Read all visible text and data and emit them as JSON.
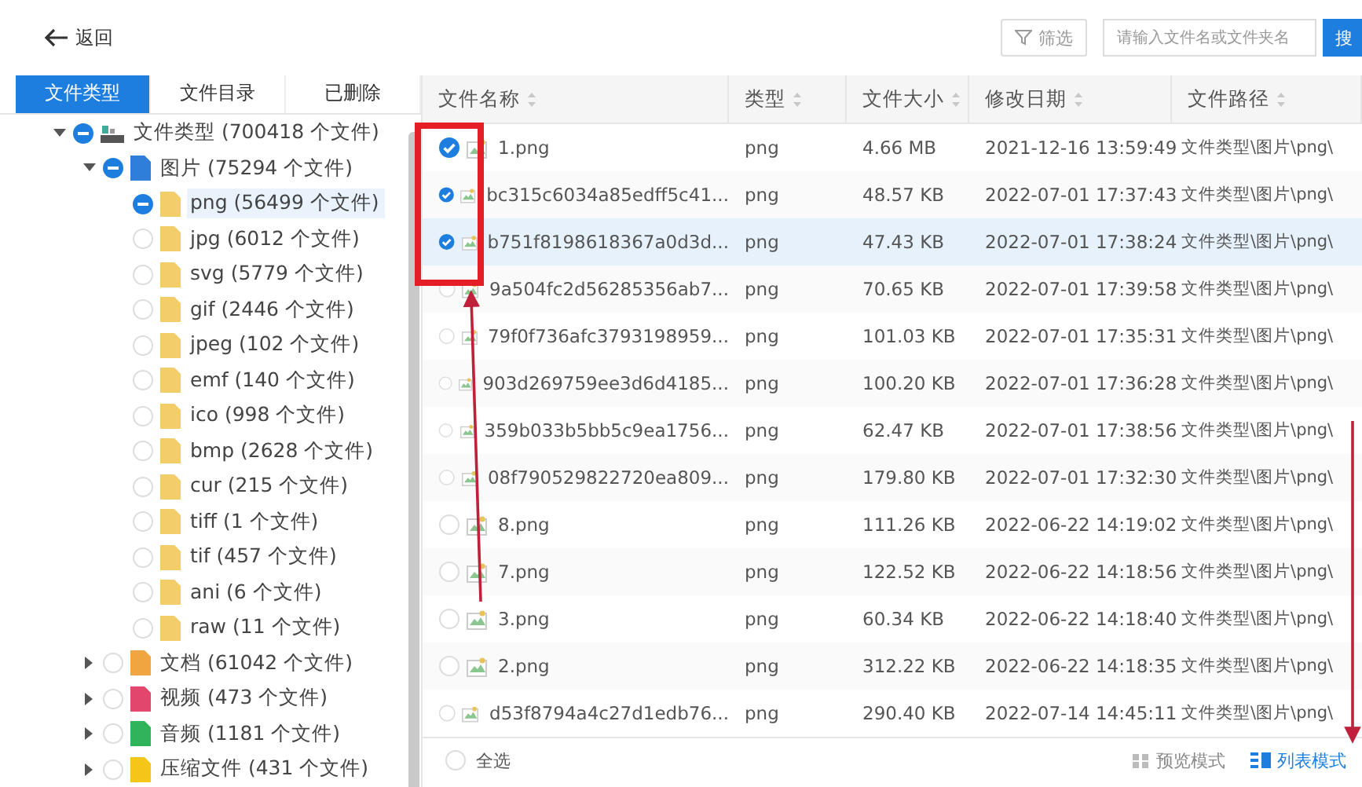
{
  "topbar": {
    "back": "返回",
    "filter": "筛选",
    "search": {
      "placeholder": "请输入文件名或文件夹名"
    },
    "search_button": "搜"
  },
  "sidebar": {
    "tabs": [
      {
        "label": "文件类型",
        "selected": true
      },
      {
        "label": "文件目录",
        "selected": false
      },
      {
        "label": "已删除",
        "selected": false
      }
    ],
    "tree": [
      {
        "label": "文件类型 (700418 个文件)",
        "kind": "drive",
        "checked": false,
        "indeterminate": true,
        "selected": false,
        "expanded": true,
        "children": [
          {
            "label": "图片 (75294 个文件)",
            "kind": "folder",
            "color": "#2f7fd8",
            "checked": false,
            "indeterminate": true,
            "selected": false,
            "expanded": true,
            "children": [
              {
                "label": "png (56499 个文件)",
                "kind": "folder",
                "color": "#f3cd6a",
                "checked": false,
                "indeterminate": true,
                "selected": true
              },
              {
                "label": "jpg (6012 个文件)",
                "kind": "folder",
                "color": "#f3cd6a",
                "checked": false,
                "indeterminate": false,
                "selected": false
              },
              {
                "label": "svg (5779 个文件)",
                "kind": "folder",
                "color": "#f3cd6a",
                "checked": false,
                "indeterminate": false,
                "selected": false
              },
              {
                "label": "gif (2446 个文件)",
                "kind": "folder",
                "color": "#f3cd6a",
                "checked": false,
                "indeterminate": false,
                "selected": false
              },
              {
                "label": "jpeg (102 个文件)",
                "kind": "folder",
                "color": "#f3cd6a",
                "checked": false,
                "indeterminate": false,
                "selected": false
              },
              {
                "label": "emf (140 个文件)",
                "kind": "folder",
                "color": "#f3cd6a",
                "checked": false,
                "indeterminate": false,
                "selected": false
              },
              {
                "label": "ico (998 个文件)",
                "kind": "folder",
                "color": "#f3cd6a",
                "checked": false,
                "indeterminate": false,
                "selected": false
              },
              {
                "label": "bmp (2628 个文件)",
                "kind": "folder",
                "color": "#f3cd6a",
                "checked": false,
                "indeterminate": false,
                "selected": false
              },
              {
                "label": "cur (215 个文件)",
                "kind": "folder",
                "color": "#f3cd6a",
                "checked": false,
                "indeterminate": false,
                "selected": false
              },
              {
                "label": "tiff (1 个文件)",
                "kind": "folder",
                "color": "#f3cd6a",
                "checked": false,
                "indeterminate": false,
                "selected": false
              },
              {
                "label": "tif (457 个文件)",
                "kind": "folder",
                "color": "#f3cd6a",
                "checked": false,
                "indeterminate": false,
                "selected": false
              },
              {
                "label": "ani (6 个文件)",
                "kind": "folder",
                "color": "#f3cd6a",
                "checked": false,
                "indeterminate": false,
                "selected": false
              },
              {
                "label": "raw (11 个文件)",
                "kind": "folder",
                "color": "#f3cd6a",
                "checked": false,
                "indeterminate": false,
                "selected": false
              }
            ]
          },
          {
            "label": "文档 (61042 个文件)",
            "kind": "folder",
            "color": "#f0a540",
            "checked": false,
            "indeterminate": false,
            "selected": false,
            "expanded": false
          },
          {
            "label": "视频 (473 个文件)",
            "kind": "folder",
            "color": "#e2466c",
            "checked": false,
            "indeterminate": false,
            "selected": false,
            "expanded": false
          },
          {
            "label": "音频 (1181 个文件)",
            "kind": "folder",
            "color": "#2fb45a",
            "checked": false,
            "indeterminate": false,
            "selected": false,
            "expanded": false
          },
          {
            "label": "压缩文件 (431 个文件)",
            "kind": "folder",
            "color": "#f5c518",
            "checked": false,
            "indeterminate": false,
            "selected": false,
            "expanded": false
          }
        ]
      }
    ]
  },
  "table": {
    "columns": [
      "文件名称",
      "类型",
      "文件大小",
      "修改日期",
      "文件路径"
    ],
    "rows": [
      {
        "name": "1.png",
        "type": "png",
        "size": "4.66 MB",
        "date": "2021-12-16 13:59:49",
        "path": "文件类型\\图片\\png\\",
        "checked": true,
        "selected": false
      },
      {
        "name": "bc315c6034a85edff5c41...",
        "type": "png",
        "size": "48.57 KB",
        "date": "2022-07-01 17:37:43",
        "path": "文件类型\\图片\\png\\",
        "checked": true,
        "selected": false
      },
      {
        "name": "b751f8198618367a0d3d...",
        "type": "png",
        "size": "47.43 KB",
        "date": "2022-07-01 17:38:24",
        "path": "文件类型\\图片\\png\\",
        "checked": true,
        "selected": true
      },
      {
        "name": "9a504fc2d56285356ab7...",
        "type": "png",
        "size": "70.65 KB",
        "date": "2022-07-01 17:39:58",
        "path": "文件类型\\图片\\png\\",
        "checked": false,
        "selected": false
      },
      {
        "name": "79f0f736afc3793198959...",
        "type": "png",
        "size": "101.03 KB",
        "date": "2022-07-01 17:35:31",
        "path": "文件类型\\图片\\png\\",
        "checked": false,
        "selected": false
      },
      {
        "name": "903d269759ee3d6d4185...",
        "type": "png",
        "size": "100.20 KB",
        "date": "2022-07-01 17:36:28",
        "path": "文件类型\\图片\\png\\",
        "checked": false,
        "selected": false
      },
      {
        "name": "359b033b5bb5c9ea1756...",
        "type": "png",
        "size": "62.47 KB",
        "date": "2022-07-01 17:38:56",
        "path": "文件类型\\图片\\png\\",
        "checked": false,
        "selected": false
      },
      {
        "name": "08f790529822720ea809...",
        "type": "png",
        "size": "179.80 KB",
        "date": "2022-07-01 17:32:30",
        "path": "文件类型\\图片\\png\\",
        "checked": false,
        "selected": false
      },
      {
        "name": "8.png",
        "type": "png",
        "size": "111.26 KB",
        "date": "2022-06-22 14:19:02",
        "path": "文件类型\\图片\\png\\",
        "checked": false,
        "selected": false
      },
      {
        "name": "7.png",
        "type": "png",
        "size": "122.52 KB",
        "date": "2022-06-22 14:18:56",
        "path": "文件类型\\图片\\png\\",
        "checked": false,
        "selected": false
      },
      {
        "name": "3.png",
        "type": "png",
        "size": "60.34 KB",
        "date": "2022-06-22 14:18:40",
        "path": "文件类型\\图片\\png\\",
        "checked": false,
        "selected": false
      },
      {
        "name": "2.png",
        "type": "png",
        "size": "312.22 KB",
        "date": "2022-06-22 14:18:35",
        "path": "文件类型\\图片\\png\\",
        "checked": false,
        "selected": false
      },
      {
        "name": "d53f8794a4c27d1edb76...",
        "type": "png",
        "size": "290.40 KB",
        "date": "2022-07-14 14:45:11",
        "path": "文件类型\\图片\\png\\",
        "checked": false,
        "selected": false
      }
    ]
  },
  "footer": {
    "select_all": {
      "label": "全选",
      "checked": false
    },
    "views": [
      {
        "label": "预览模式",
        "selected": false
      },
      {
        "label": "列表模式",
        "selected": true
      }
    ]
  },
  "annotations": [
    {
      "kind": "box"
    },
    {
      "kind": "arrow"
    },
    {
      "kind": "arrow"
    }
  ]
}
